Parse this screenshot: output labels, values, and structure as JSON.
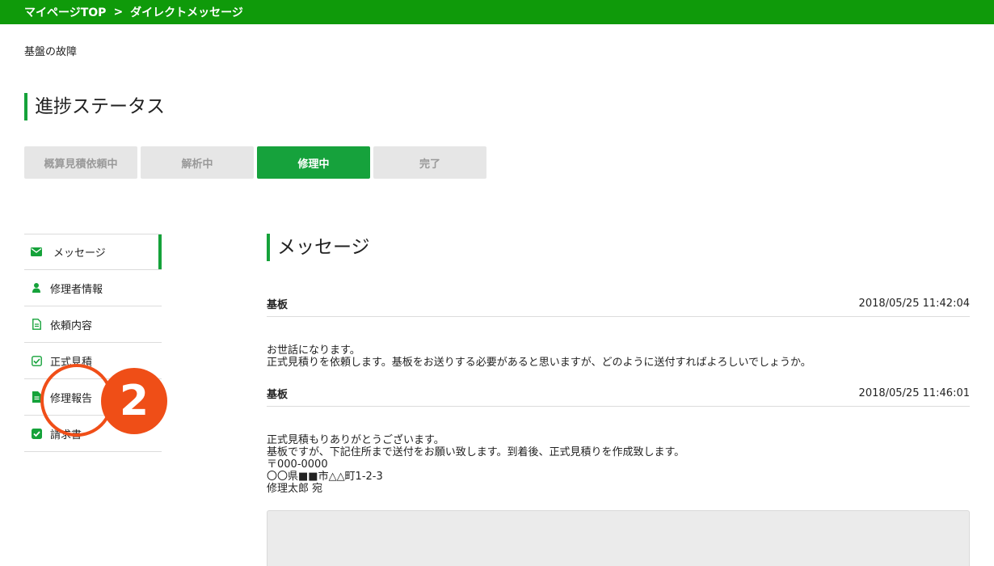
{
  "breadcrumb": {
    "home": "マイページTOP",
    "separator": ">",
    "current": "ダイレクトメッセージ"
  },
  "page_subtitle": "基盤の故障",
  "progress": {
    "title": "進捗ステータス",
    "steps": [
      {
        "label": "概算見積依頼中",
        "active": false
      },
      {
        "label": "解析中",
        "active": false
      },
      {
        "label": "修理中",
        "active": true
      },
      {
        "label": "完了",
        "active": false
      }
    ]
  },
  "sidebar": {
    "items": [
      {
        "label": "メッセージ",
        "icon": "envelope-icon"
      },
      {
        "label": "修理者情報",
        "icon": "user-icon"
      },
      {
        "label": "依頼内容",
        "icon": "document-outline-icon"
      },
      {
        "label": "正式見積",
        "icon": "checkbox-outline-icon"
      },
      {
        "label": "修理報告",
        "icon": "document-filled-icon"
      },
      {
        "label": "請求書",
        "icon": "checkbox-filled-icon"
      }
    ]
  },
  "callout": {
    "number": "2"
  },
  "messages_section": {
    "title": "メッセージ",
    "messages": [
      {
        "sender": "基板",
        "timestamp": "2018/05/25 11:42:04",
        "lines": [
          "お世話になります。",
          "正式見積りを依頼します。基板をお送りする必要があると思いますが、どのように送付すればよろしいでしょうか。"
        ]
      },
      {
        "sender": "基板",
        "timestamp": "2018/05/25 11:46:01",
        "lines": [
          "正式見積もりありがとうございます。",
          "基板ですが、下記住所まで送付をお願い致します。到着後、正式見積りを作成致します。",
          "〒000-0000",
          "〇〇県■■市△△町1-2-3",
          "修理太郎 宛"
        ]
      }
    ]
  },
  "colors": {
    "topbar": "#0f9a0a",
    "accent": "#15a23a",
    "callout": "#ef4e17",
    "step_inactive": "#e6e6e6"
  }
}
